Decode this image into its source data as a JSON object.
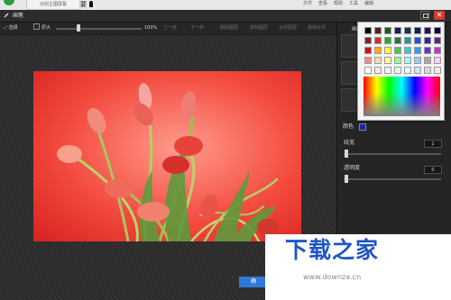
{
  "top_bar": {
    "tab_label": "识别主图屏幕",
    "user_name": "要",
    "menu": [
      "文件",
      "查看",
      "帮助",
      "工具",
      "编辑"
    ]
  },
  "dialog": {
    "title": "画笔",
    "minimize_icon": "minimize-icon",
    "close_glyph": "✕"
  },
  "toolbar": {
    "select_label": "选择",
    "size_label": "原大",
    "zoom_value": "100%",
    "zoom_fraction": 0.26,
    "actions": [
      {
        "label": "上一步",
        "enabled": false
      },
      {
        "label": "下一步",
        "enabled": false
      },
      {
        "label": "删除图层",
        "enabled": false
      },
      {
        "label": "复制图层",
        "enabled": false
      },
      {
        "label": "合并图层",
        "enabled": false
      },
      {
        "label": "撤销合并",
        "enabled": false
      }
    ]
  },
  "canvas": {
    "image_subject": "tulips-photo",
    "ok_label": "确"
  },
  "right_panel": {
    "top_label": "画",
    "color_label": "颜色",
    "color_value": "#1428a8",
    "line_width_label": "线宽",
    "line_width_value": "1",
    "opacity_label": "透明度",
    "opacity_value": "0"
  },
  "color_picker": {
    "swatches": [
      "#000000",
      "#5c1a1a",
      "#1a5c1a",
      "#1a1a5c",
      "#113355",
      "#112255",
      "#221166",
      "#110044",
      "#882222",
      "#cc3322",
      "#22aa33",
      "#227744",
      "#229999",
      "#2255cc",
      "#3322aa",
      "#662288",
      "#cc1111",
      "#ffaa00",
      "#ffff33",
      "#44cc44",
      "#33cccc",
      "#3399ff",
      "#6633cc",
      "#cc33cc",
      "#ff8888",
      "#ffdd99",
      "#ffff99",
      "#99ff99",
      "#99ffff",
      "#99ccff",
      "#aaaaaa",
      "#ffccff",
      "#ffffff",
      "#ffe4e4",
      "#f0f0f0",
      "#e0ffe0",
      "#e0ffff",
      "#cfe8ff",
      "#d8d8d8",
      "#f6e6f6"
    ]
  },
  "watermark": {
    "text": "下载之家",
    "url": "www.downza.cn"
  }
}
